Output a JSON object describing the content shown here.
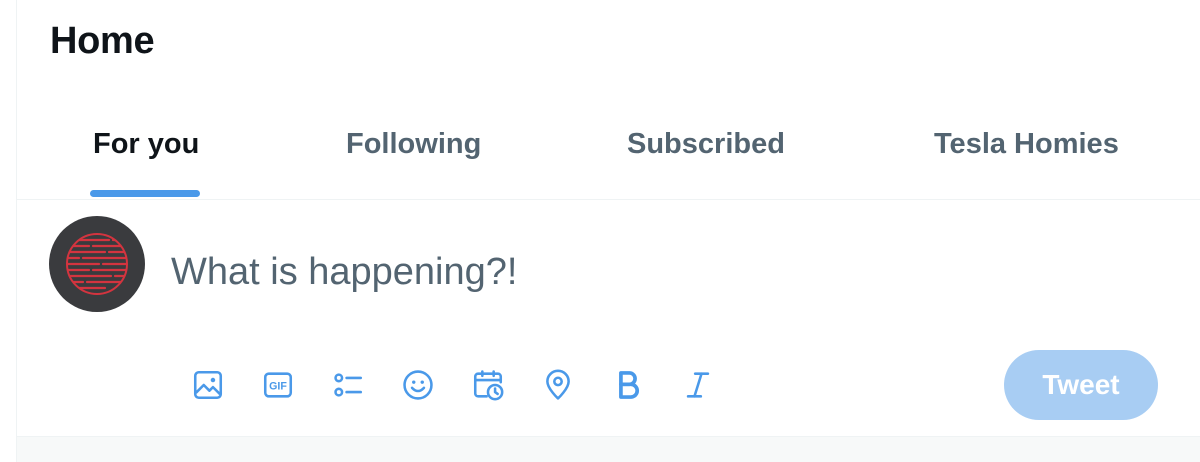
{
  "header": {
    "title": "Home"
  },
  "tabs": [
    {
      "label": "For you",
      "active": true
    },
    {
      "label": "Following",
      "active": false
    },
    {
      "label": "Subscribed",
      "active": false
    },
    {
      "label": "Tesla Homies",
      "active": false
    }
  ],
  "composer": {
    "placeholder": "What is happening?!",
    "value": "",
    "tools": [
      {
        "icon": "image-icon"
      },
      {
        "icon": "gif-icon"
      },
      {
        "icon": "poll-icon"
      },
      {
        "icon": "emoji-icon"
      },
      {
        "icon": "schedule-icon"
      },
      {
        "icon": "location-icon"
      },
      {
        "icon": "bold-icon"
      },
      {
        "icon": "italic-icon"
      }
    ],
    "tweet_label": "Tweet",
    "gif_text": "GIF"
  },
  "colors": {
    "accent": "#4a99e9",
    "tweet_disabled": "#a8cdf3",
    "text_primary": "#0f1419",
    "text_secondary": "#536471",
    "avatar_bg": "#3a3b3e",
    "avatar_lines": "#d3343f"
  }
}
